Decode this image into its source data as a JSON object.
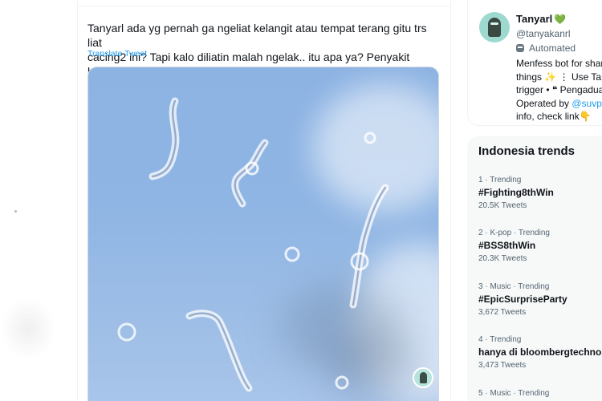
{
  "tweet": {
    "text": "Tanyarl ada yg pernah ga ngeliat kelangit atau tempat terang gitu trs liat\ncacing2 ini? Tapi kalo diliatin malah ngelak.. itu apa ya? Penyakit bukan?",
    "translate_label": "Translate Tweet",
    "media_icon": "floaters-sky-photo"
  },
  "profile": {
    "name": "Tanyarl",
    "heart": "💚",
    "handle": "@tanyakanrl",
    "automated_label": "Automated",
    "automated_icon": "robot-icon",
    "bio_lines": [
      "Menfess bot for shar",
      "things ✨ ⋮ Use Tany",
      "trigger • ❝ Pengaduar",
      "Operated by ",
      "info, check link👇"
    ],
    "bio_link": "@suvpe"
  },
  "trends": {
    "title": "Indonesia trends",
    "items": [
      {
        "meta": "1 · Trending",
        "name": "#Fighting8thWin",
        "count": "20.5K Tweets"
      },
      {
        "meta": "2 · K-pop · Trending",
        "name": "#BSS8thWin",
        "count": "20.3K Tweets"
      },
      {
        "meta": "3 · Music · Trending",
        "name": "#EpicSurpriseParty",
        "count": "3,672 Tweets"
      },
      {
        "meta": "4 · Trending",
        "name": "hanya di bloombergtechnoz",
        "count": "3,473 Tweets"
      },
      {
        "meta": "5 · Music · Trending",
        "name": "",
        "count": ""
      }
    ]
  },
  "colors": {
    "accent": "#1d9bf0",
    "text": "#0f1419",
    "secondary": "#536471",
    "sky": "#8fb5e4"
  }
}
